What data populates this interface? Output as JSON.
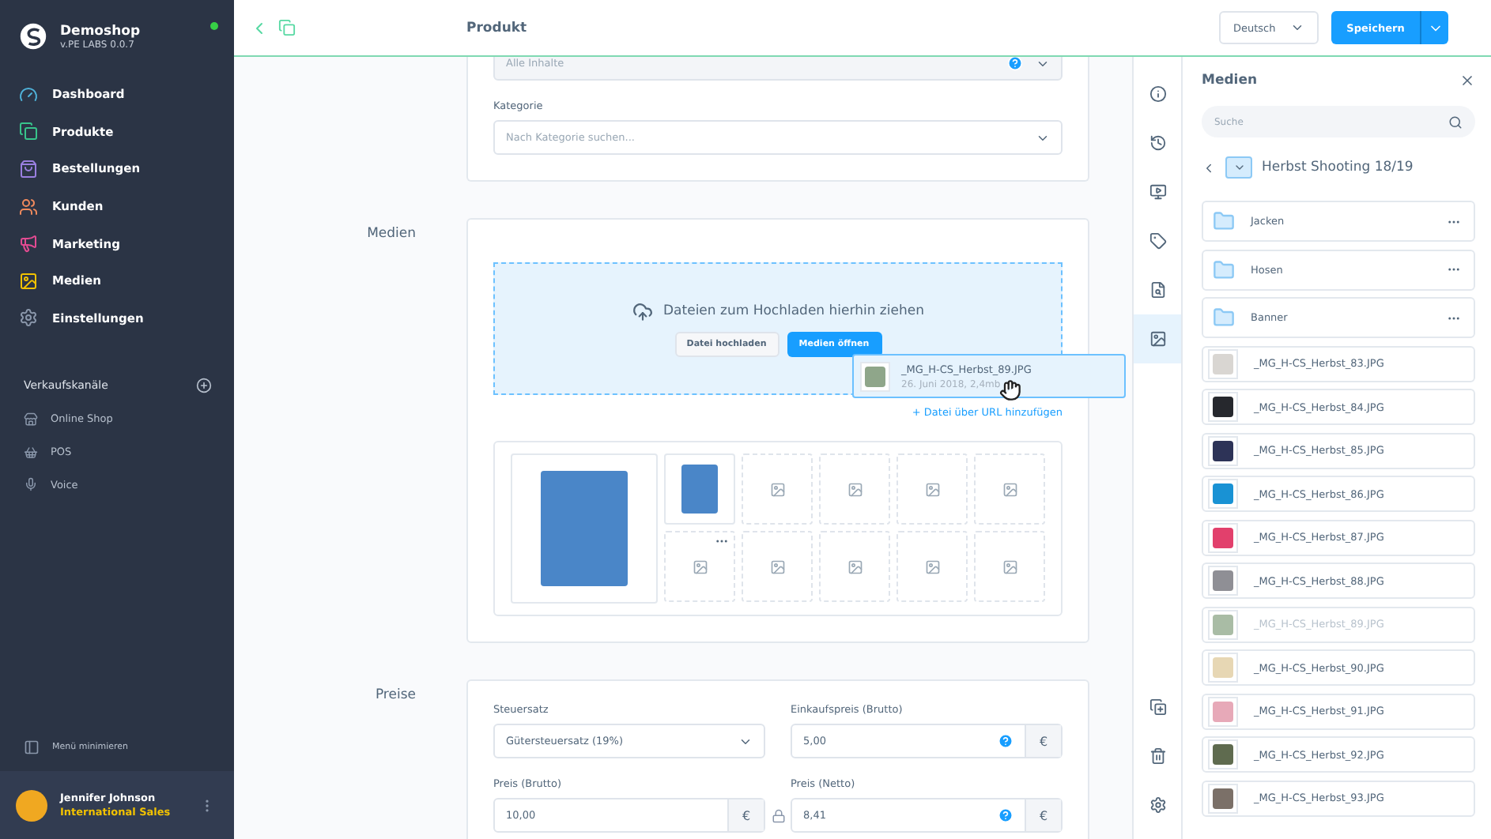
{
  "sidebar": {
    "shop_name": "Demoshop",
    "version": "v.PE LABS 0.0.7",
    "online": true,
    "nav": [
      {
        "label": "Dashboard",
        "color": "#4fb1d8"
      },
      {
        "label": "Produkte",
        "color": "#38c48b"
      },
      {
        "label": "Bestellungen",
        "color": "#9a7fe0"
      },
      {
        "label": "Kunden",
        "color": "#f08a5d"
      },
      {
        "label": "Marketing",
        "color": "#e34b92"
      },
      {
        "label": "Medien",
        "color": "#f2c200"
      },
      {
        "label": "Einstellungen",
        "color": "#8a97ab"
      }
    ],
    "channels_title": "Verkaufskanäle",
    "channels": [
      "Online Shop",
      "POS",
      "Voice"
    ],
    "minimize": "Menü minimieren",
    "user": {
      "name": "Jennifer Johnson",
      "role": "International Sales"
    }
  },
  "header": {
    "title": "Produkt",
    "language": "Deutsch",
    "save": "Speichern"
  },
  "visibility_card": {
    "placeholder": "Alle Inhalte",
    "category_label": "Kategorie",
    "category_placeholder": "Nach Kategorie suchen..."
  },
  "media_section": {
    "title": "Medien",
    "drop_text": "Dateien zum Hochladen hierhin ziehen",
    "upload_button": "Datei hochladen",
    "open_button": "Medien öffnen",
    "url_link": "+ Datei über URL hinzufügen",
    "drag_item": {
      "name": "_MG_H-CS_Herbst_89.JPG",
      "meta": "26. Juni 2018, 2,4mb",
      "color": "#8fa68a"
    },
    "slots": [
      {
        "kind": "photo",
        "color": "#4a86c8"
      },
      {
        "kind": "photo",
        "color": "#4a86c8"
      },
      {
        "kind": "empty"
      },
      {
        "kind": "empty"
      },
      {
        "kind": "empty"
      },
      {
        "kind": "empty"
      },
      {
        "kind": "empty"
      },
      {
        "kind": "empty"
      },
      {
        "kind": "empty"
      },
      {
        "kind": "empty"
      },
      {
        "kind": "empty"
      }
    ]
  },
  "prices_section": {
    "title": "Preise",
    "fields": [
      {
        "label": "Steuersatz",
        "value": "Gütersteuersatz (19%)",
        "kind": "select"
      },
      {
        "label": "Einkaufspreis (Brutto)",
        "value": "5,00",
        "kind": "currency",
        "help": true,
        "currency": "€",
        "locked": false
      },
      {
        "label": "Preis (Brutto)",
        "value": "10,00",
        "kind": "currency",
        "help": false,
        "currency": "€",
        "locked": true
      },
      {
        "label": "Preis (Netto)",
        "value": "8,41",
        "kind": "currency",
        "help": true,
        "currency": "€",
        "locked": false
      }
    ]
  },
  "toolbar": {
    "tabs": [
      {
        "selected": false
      },
      {
        "selected": false
      },
      {
        "selected": false
      },
      {
        "selected": false
      },
      {
        "selected": false
      },
      {
        "selected": true
      }
    ]
  },
  "media_panel": {
    "title": "Medien",
    "search_placeholder": "Suche",
    "folder": "Herbst Shooting 18/19",
    "items": [
      {
        "kind": "folder",
        "name": "Jacken"
      },
      {
        "kind": "folder",
        "name": "Hosen"
      },
      {
        "kind": "folder",
        "name": "Banner"
      },
      {
        "kind": "file",
        "name": "_MG_H-CS_Herbst_83.JPG",
        "color": "#d9d6d2",
        "dragging": false
      },
      {
        "kind": "file",
        "name": "_MG_H-CS_Herbst_84.JPG",
        "color": "#26282d",
        "dragging": false
      },
      {
        "kind": "file",
        "name": "_MG_H-CS_Herbst_85.JPG",
        "color": "#2d3357",
        "dragging": false
      },
      {
        "kind": "file",
        "name": "_MG_H-CS_Herbst_86.JPG",
        "color": "#1992d4",
        "dragging": false
      },
      {
        "kind": "file",
        "name": "_MG_H-CS_Herbst_87.JPG",
        "color": "#e2406c",
        "dragging": false
      },
      {
        "kind": "file",
        "name": "_MG_H-CS_Herbst_88.JPG",
        "color": "#8f8f95",
        "dragging": false
      },
      {
        "kind": "file",
        "name": "_MG_H-CS_Herbst_89.JPG",
        "color": "#a9bca5",
        "dragging": true
      },
      {
        "kind": "file",
        "name": "_MG_H-CS_Herbst_90.JPG",
        "color": "#e7d7b4",
        "dragging": false
      },
      {
        "kind": "file",
        "name": "_MG_H-CS_Herbst_91.JPG",
        "color": "#e7a9b8",
        "dragging": false
      },
      {
        "kind": "file",
        "name": "_MG_H-CS_Herbst_92.JPG",
        "color": "#5f6b4f",
        "dragging": false
      },
      {
        "kind": "file",
        "name": "_MG_H-CS_Herbst_93.JPG",
        "color": "#7b7068",
        "dragging": false
      }
    ]
  }
}
